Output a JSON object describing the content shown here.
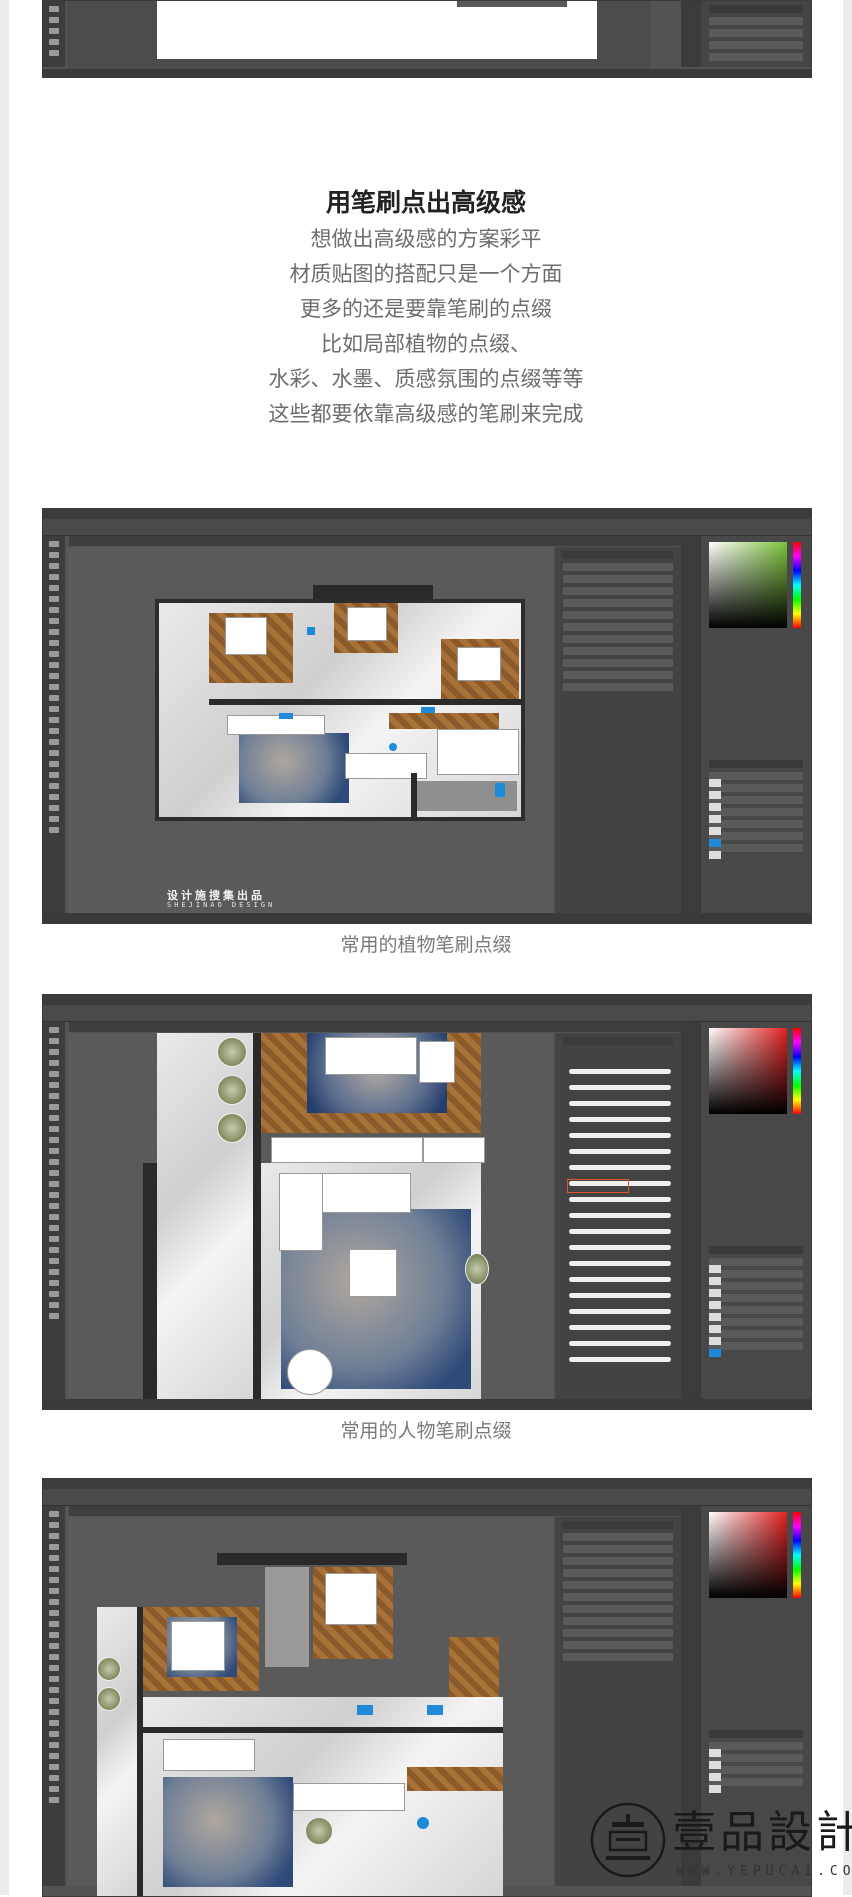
{
  "article": {
    "title": "用笔刷点出高级感",
    "paragraph_lines": [
      "想做出高级感的方案彩平",
      "材质贴图的搭配只是一个方面",
      "更多的还是要靠笔刷的点缀",
      "比如局部植物的点缀、",
      "水彩、水墨、质感氛围的点缀等等",
      "这些都要依靠高级感的笔刷来完成"
    ]
  },
  "screenshots": [
    {
      "name": "top-cropped-screenshot",
      "caption": ""
    },
    {
      "name": "plant-brush-screenshot",
      "caption": "常用的植物笔刷点缀",
      "plan_label": "设计施搜集出品",
      "plan_sublabel": "SHEJINAO DESIGN"
    },
    {
      "name": "people-brush-screenshot",
      "caption": "常用的人物笔刷点缀"
    },
    {
      "name": "bottom-screenshot",
      "caption": ""
    }
  ],
  "logo": {
    "text": "壹品設計",
    "url": "WWW.YEPUCAI.COM"
  },
  "colors": {
    "ps_background": "#535353",
    "accent_orange": "#e0562a",
    "accent_blue": "#1e8bd9",
    "wood": "#a87138"
  }
}
